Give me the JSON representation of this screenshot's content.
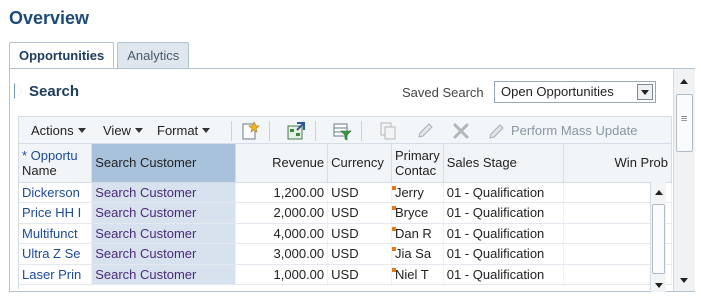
{
  "page": {
    "title": "Overview"
  },
  "tabs": [
    {
      "label": "Opportunities",
      "active": true
    },
    {
      "label": "Analytics",
      "active": false
    }
  ],
  "search": {
    "title": "Search",
    "saved_label": "Saved Search",
    "saved_value": "Open Opportunities"
  },
  "toolbar": {
    "actions_label": "Actions",
    "view_label": "View",
    "format_label": "Format",
    "mass_update_label": "Perform Mass Update"
  },
  "table": {
    "headers": {
      "name": "* Opportunity Name",
      "name_line1": "* Opportu",
      "name_line2": "Name",
      "customer": "Search Customer",
      "revenue": "Revenue",
      "currency": "Currency",
      "contact_line1": "Primary",
      "contact_line2": "Contac",
      "stage": "Sales Stage",
      "winprob": "Win Prob"
    },
    "rows": [
      {
        "name": "Dickerson",
        "customer": "Search Customer",
        "revenue": "1,200.00",
        "currency": "USD",
        "contact": "Jerry",
        "stage": "01 - Qualification"
      },
      {
        "name": "Price HH I",
        "customer": "Search Customer",
        "revenue": "2,000.00",
        "currency": "USD",
        "contact": "Bryce",
        "stage": "01 - Qualification"
      },
      {
        "name": "Multifunct",
        "customer": "Search Customer",
        "revenue": "4,000.00",
        "currency": "USD",
        "contact": "Dan R",
        "stage": "01 - Qualification"
      },
      {
        "name": "Ultra Z Se",
        "customer": "Search Customer",
        "revenue": "3,000.00",
        "currency": "USD",
        "contact": "Jia Sa",
        "stage": "01 - Qualification"
      },
      {
        "name": "Laser Prin",
        "customer": "Search Customer",
        "revenue": "1,000.00",
        "currency": "USD",
        "contact": "Niel T",
        "stage": "01 - Qualification"
      }
    ]
  },
  "colors": {
    "title": "#1d4a7a",
    "selected_header": "#a9c2dc",
    "selected_cell": "#d7e2ee",
    "flag": "#e07a1a"
  }
}
